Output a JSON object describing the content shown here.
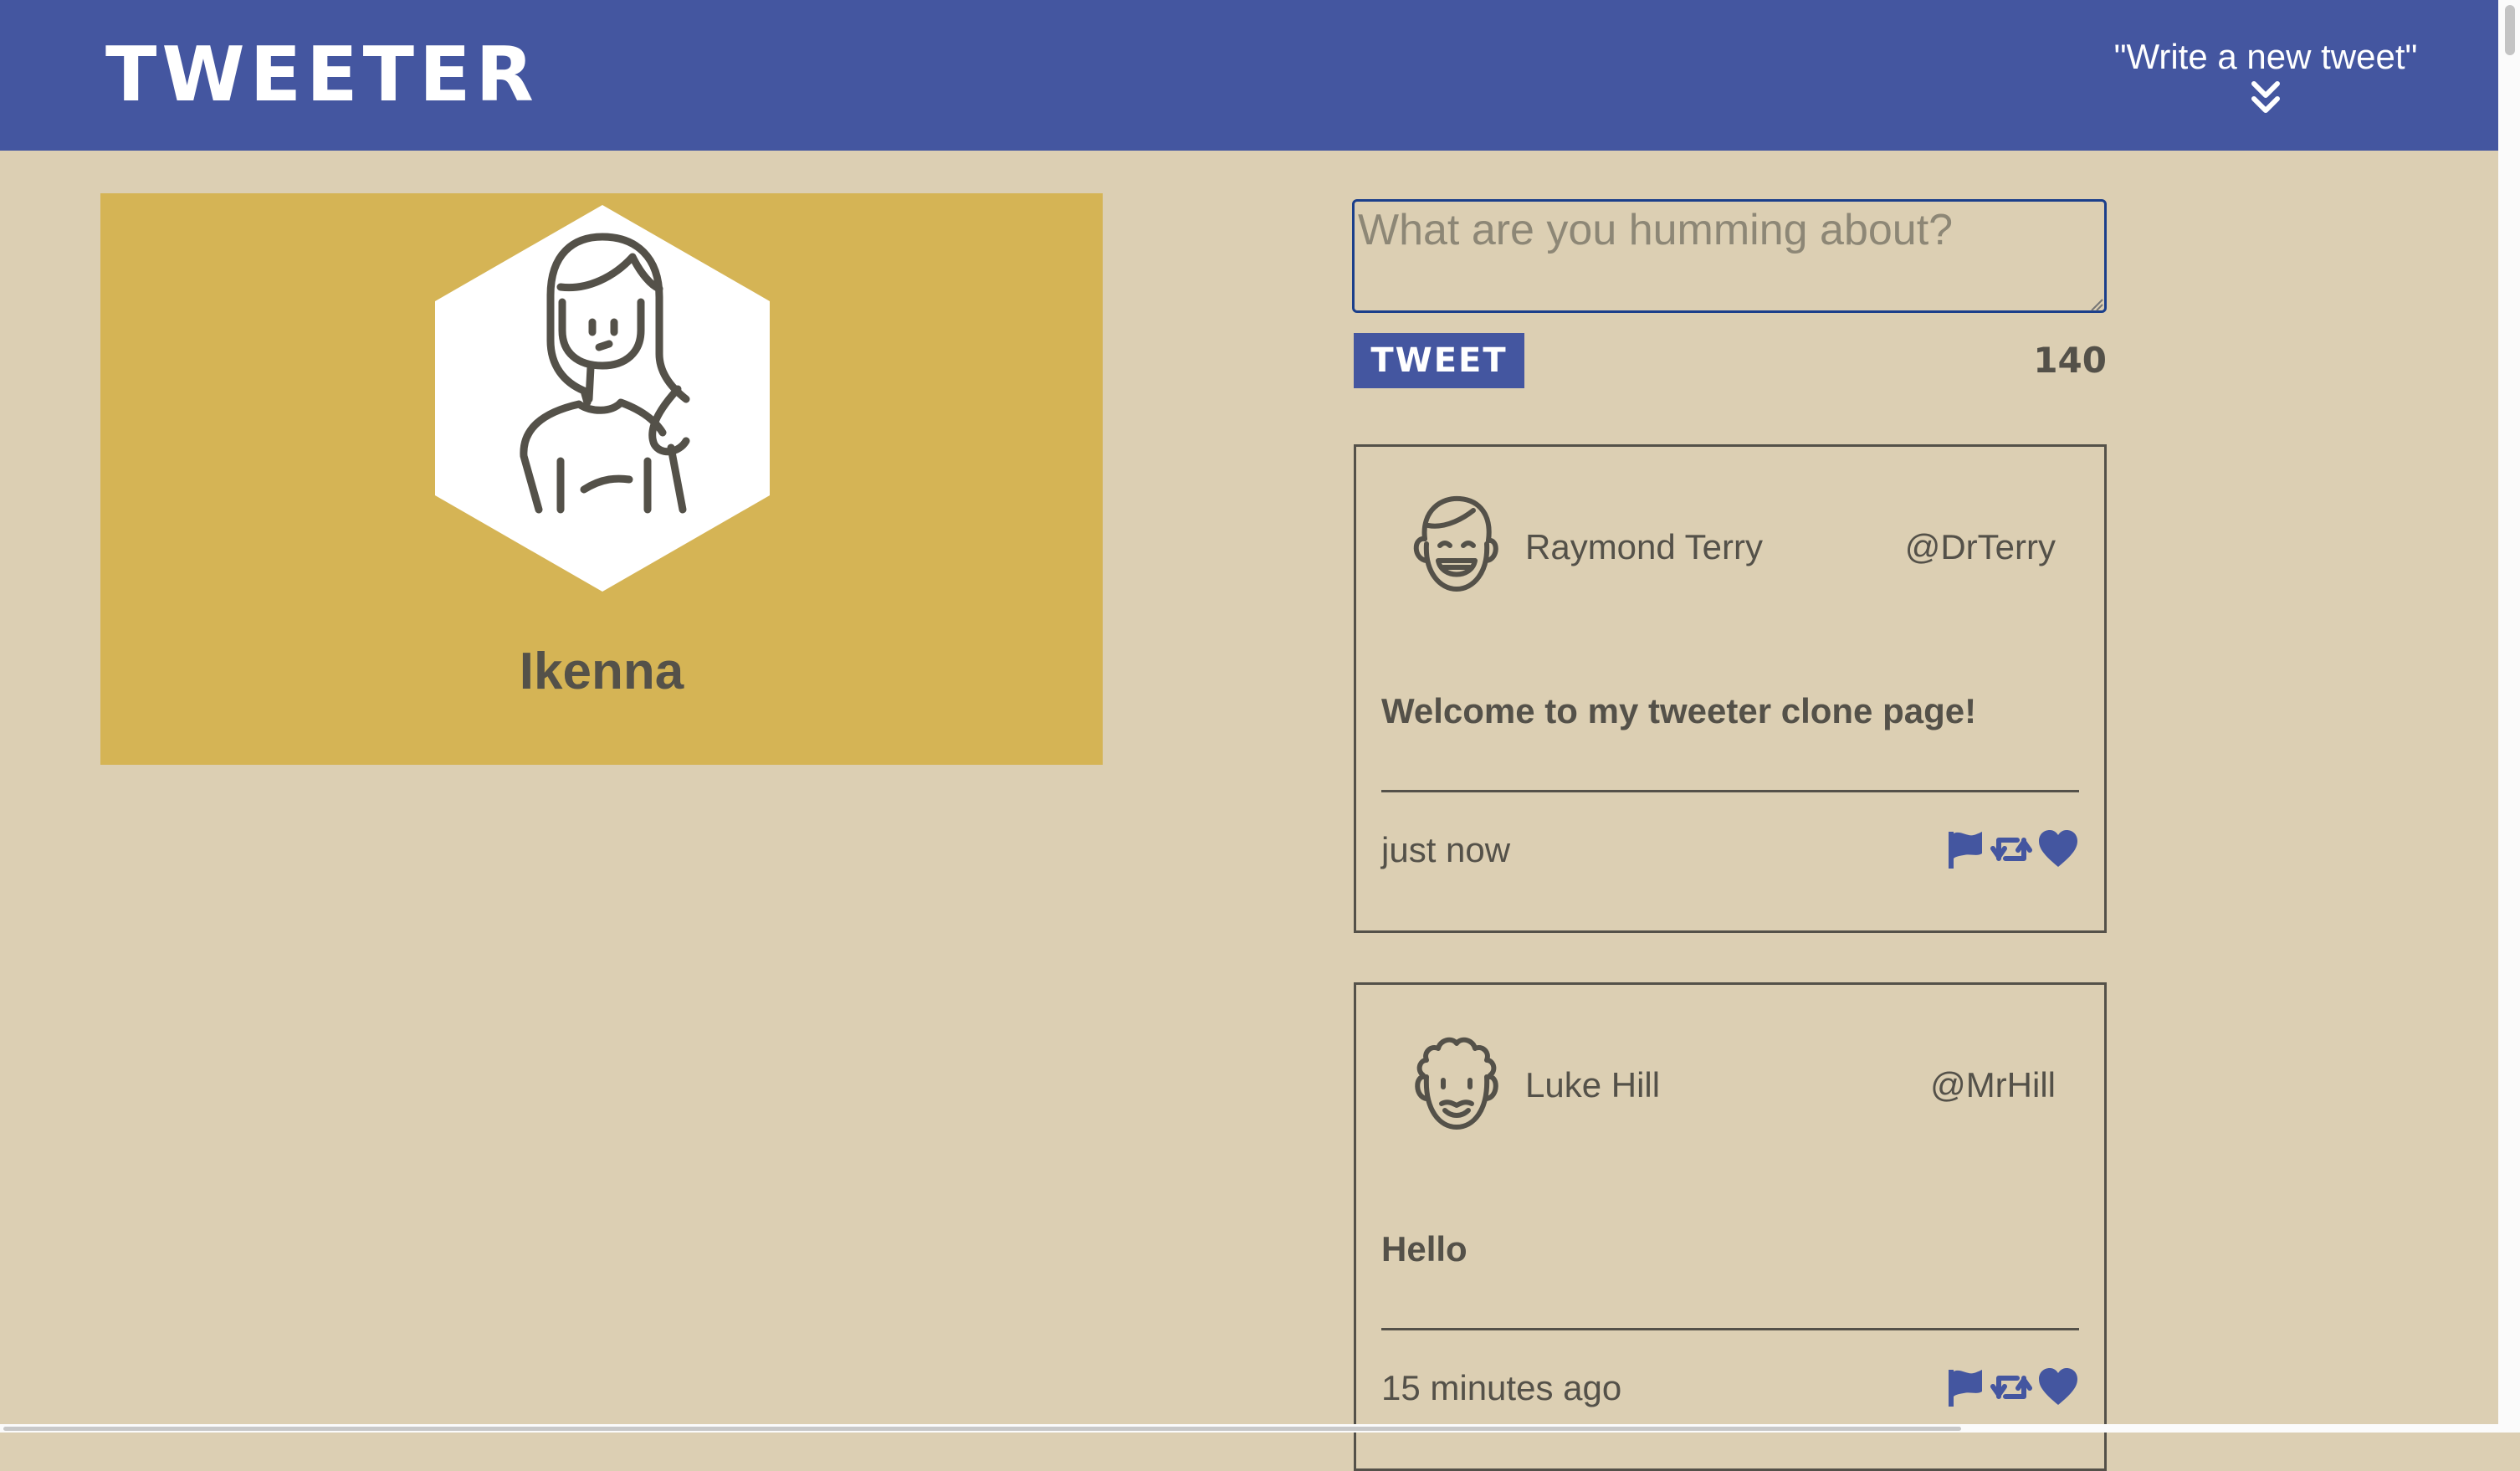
{
  "nav": {
    "brand": "TWEETER",
    "compose_label": "\"Write a new tweet\"",
    "compose_icon": "double-chevron-down-icon"
  },
  "profile": {
    "name": "Ikenna",
    "avatar_icon": "woman-avatar-icon"
  },
  "composer": {
    "placeholder": "What are you humming about?",
    "value": "",
    "button_label": "TWEET",
    "counter": "140"
  },
  "tweets": [
    {
      "name": "Raymond Terry",
      "handle": "@DrTerry",
      "content": "Welcome to my tweeter clone page!",
      "time": "just now",
      "avatar_icon": "smiling-man-avatar-icon"
    },
    {
      "name": "Luke Hill",
      "handle": "@MrHill",
      "content": "Hello",
      "time": "15 minutes ago",
      "avatar_icon": "curly-hair-man-avatar-icon"
    }
  ],
  "actions": [
    "flag-icon",
    "retweet-icon",
    "heart-icon"
  ],
  "colors": {
    "primary": "#4456a0",
    "background": "#dccfb3",
    "profile_card": "#d5b455",
    "text": "#545149",
    "input_border": "#1b3f8b"
  }
}
